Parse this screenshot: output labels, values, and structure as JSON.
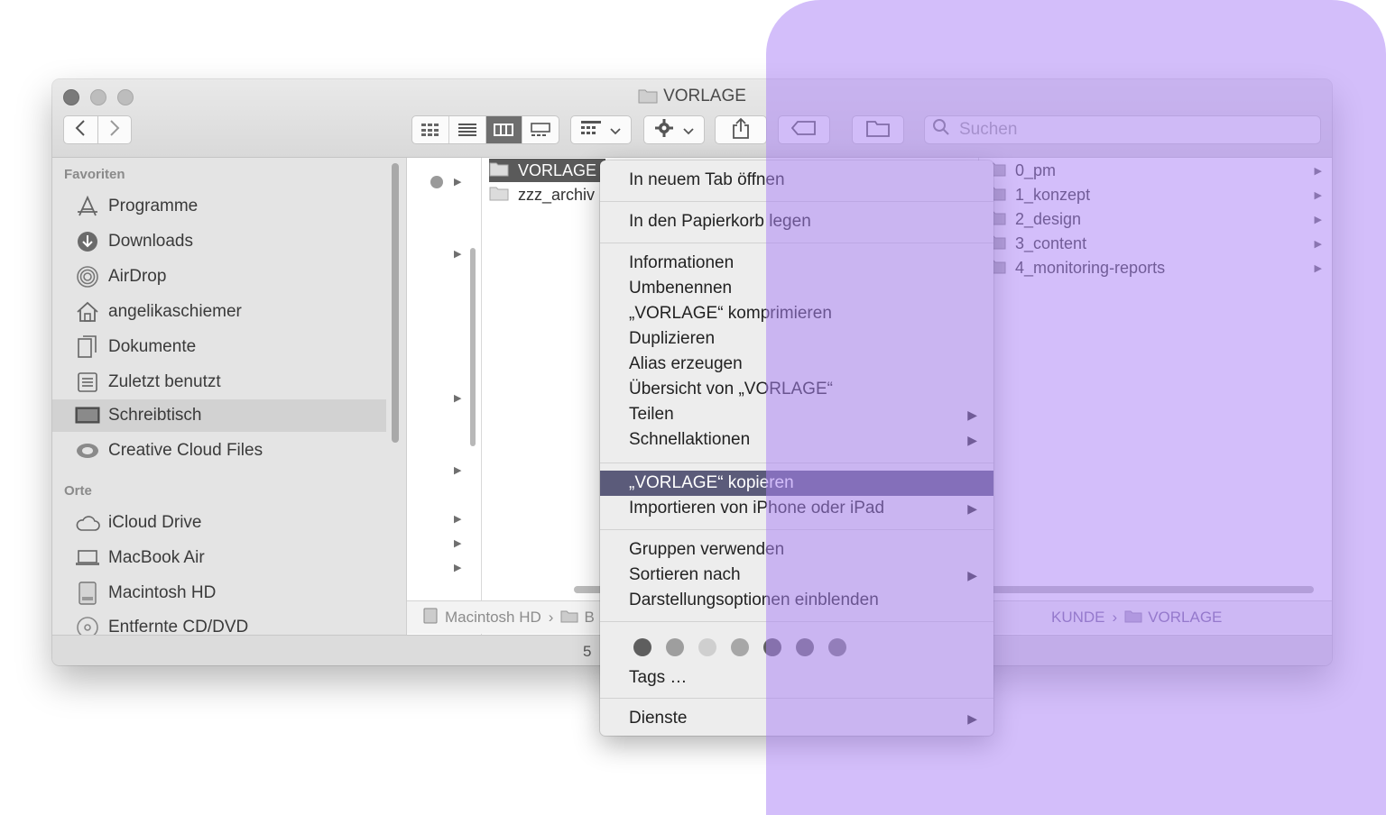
{
  "window": {
    "title": "VORLAGE",
    "status_text": "5 "
  },
  "toolbar": {
    "back_icon": "chevron-left-icon",
    "forward_icon": "chevron-right-icon",
    "view_icons": [
      "icon-view-icon",
      "list-view-icon",
      "column-view-icon",
      "gallery-view-icon"
    ],
    "active_view": "column-view",
    "group_icon": "group-icon",
    "action_icon": "gear-icon",
    "share_icon": "share-icon",
    "tag_icon": "tag-icon",
    "new_folder_icon": "new-folder-icon"
  },
  "search": {
    "placeholder": "Suchen"
  },
  "sidebar": {
    "favorites_heading": "Favoriten",
    "favorites": [
      {
        "label": "Programme",
        "icon": "applications-icon"
      },
      {
        "label": "Downloads",
        "icon": "downloads-icon"
      },
      {
        "label": "AirDrop",
        "icon": "airdrop-icon"
      },
      {
        "label": "angelikaschiemer",
        "icon": "home-icon"
      },
      {
        "label": "Dokumente",
        "icon": "documents-icon"
      },
      {
        "label": "Zuletzt benutzt",
        "icon": "recents-icon"
      },
      {
        "label": "Schreibtisch",
        "icon": "desktop-icon",
        "selected": true
      },
      {
        "label": "Creative Cloud Files",
        "icon": "creative-cloud-icon"
      }
    ],
    "places_heading": "Orte",
    "places": [
      {
        "label": "iCloud Drive",
        "icon": "cloud-icon"
      },
      {
        "label": "MacBook Air",
        "icon": "laptop-icon"
      },
      {
        "label": "Macintosh HD",
        "icon": "harddisk-icon"
      },
      {
        "label": "Entfernte CD/DVD",
        "icon": "disc-icon"
      }
    ]
  },
  "column2": {
    "items": [
      {
        "label": "VORLAGE",
        "selected": true
      },
      {
        "label": "zzz_archiv"
      }
    ]
  },
  "column3": {
    "items": [
      {
        "label": "0_pm"
      },
      {
        "label": "1_konzept"
      },
      {
        "label": "2_design"
      },
      {
        "label": "3_content"
      },
      {
        "label": "4_monitoring-reports"
      }
    ]
  },
  "pathbar": {
    "start": [
      "Macintosh HD",
      "B"
    ],
    "end": [
      "KUNDE",
      "VORLAGE"
    ]
  },
  "context_menu": {
    "open_new_tab": "In neuem Tab öffnen",
    "trash": "In den Papierkorb legen",
    "info": "Informationen",
    "rename": "Umbenennen",
    "compress": "„VORLAGE“ komprimieren",
    "duplicate": "Duplizieren",
    "alias": "Alias erzeugen",
    "quicklook": "Übersicht von „VORLAGE“",
    "share": "Teilen",
    "quick_actions": "Schnellaktionen",
    "copy": "„VORLAGE“ kopieren",
    "import": "Importieren von iPhone oder iPad",
    "groups": "Gruppen verwenden",
    "sort": "Sortieren nach",
    "view_options": "Darstellungsoptionen einblenden",
    "tag_colors": [
      "#5e5e5e",
      "#9e9e9e",
      "#cfcfcf",
      "#a7a7a7",
      "#5f5f5f",
      "#6b6b6b",
      "#7a7a7a"
    ],
    "tags": "Tags …",
    "services": "Dienste"
  },
  "overlay_color": "#aa82f5"
}
